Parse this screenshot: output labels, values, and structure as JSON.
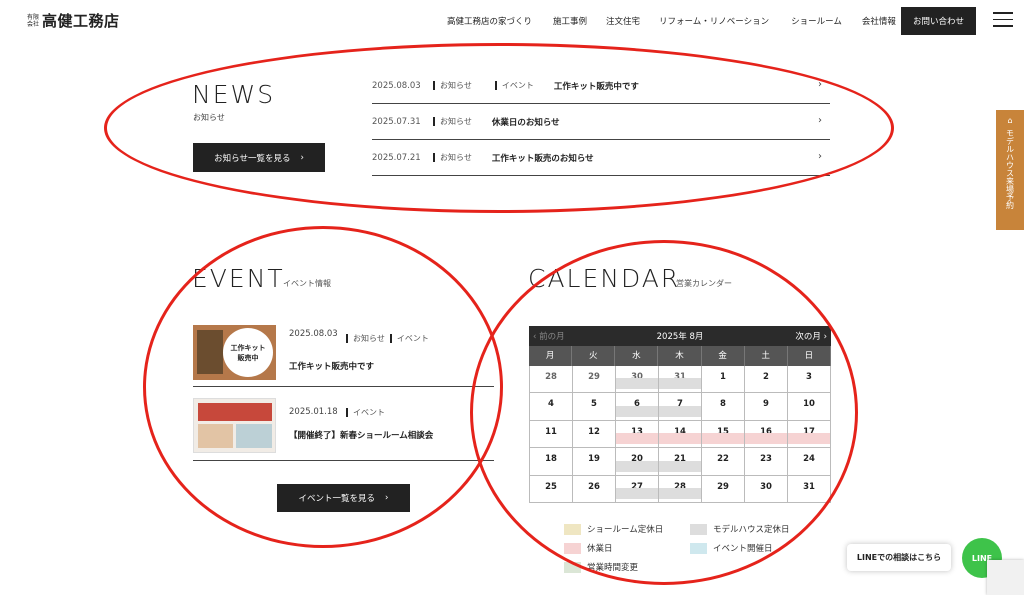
{
  "header": {
    "logo_small": "有限会社",
    "logo_main": "高健工務店",
    "nav": [
      "高健工務店の家づくり",
      "施工事例",
      "注文住宅",
      "リフォーム・リノベーション",
      "ショールーム",
      "会社情報"
    ],
    "contact": "お問い合わせ"
  },
  "news": {
    "title": "NEWS",
    "subtitle": "お知らせ",
    "more": "お知らせ一覧を見る",
    "items": [
      {
        "date": "2025.08.03",
        "tag1": "お知らせ",
        "tag2": "イベント",
        "title": "工作キット販売中です"
      },
      {
        "date": "2025.07.31",
        "tag1": "お知らせ",
        "tag2": "",
        "title": "休業日のお知らせ"
      },
      {
        "date": "2025.07.21",
        "tag1": "お知らせ",
        "tag2": "",
        "title": "工作キット販売のお知らせ"
      }
    ]
  },
  "event": {
    "title": "EVENT",
    "subtitle": "イベント情報",
    "items": [
      {
        "date": "2025.08.03",
        "tag1": "お知らせ",
        "tag2": "イベント",
        "title": "工作キット販売中です",
        "thumb_text1": "工作キット",
        "thumb_text2": "販売中"
      },
      {
        "date": "2025.01.18",
        "tag1": "イベント",
        "tag2": "",
        "title": "【開催終了】新春ショールーム相談会"
      }
    ],
    "more": "イベント一覧を見る"
  },
  "calendar": {
    "title": "CALENDAR",
    "subtitle": "営業カレンダー",
    "prev": "前の月",
    "month": "2025年 8月",
    "next": "次の月",
    "dow": [
      "月",
      "火",
      "水",
      "木",
      "金",
      "土",
      "日"
    ],
    "weeks": [
      [
        "28",
        "29",
        "30",
        "31",
        "1",
        "2",
        "3"
      ],
      [
        "4",
        "5",
        "6",
        "7",
        "8",
        "9",
        "10"
      ],
      [
        "11",
        "12",
        "13",
        "14",
        "15",
        "16",
        "17"
      ],
      [
        "18",
        "19",
        "20",
        "21",
        "22",
        "23",
        "24"
      ],
      [
        "25",
        "26",
        "27",
        "28",
        "29",
        "30",
        "31"
      ]
    ],
    "legend": [
      "ショールーム定休日",
      "モデルハウス定休日",
      "休業日",
      "イベント開催日",
      "営業時間変更"
    ],
    "colors": {
      "showroom": "#efe6c2",
      "modelhouse": "#dddddd",
      "holiday": "#f6d3d3",
      "event": "#cfe8ee",
      "hours": "#dbe6d6"
    }
  },
  "side_tab": "モデルハウス来場予約",
  "line": {
    "bubble": "LINEでの相談はこちら",
    "icon": "LINE"
  }
}
